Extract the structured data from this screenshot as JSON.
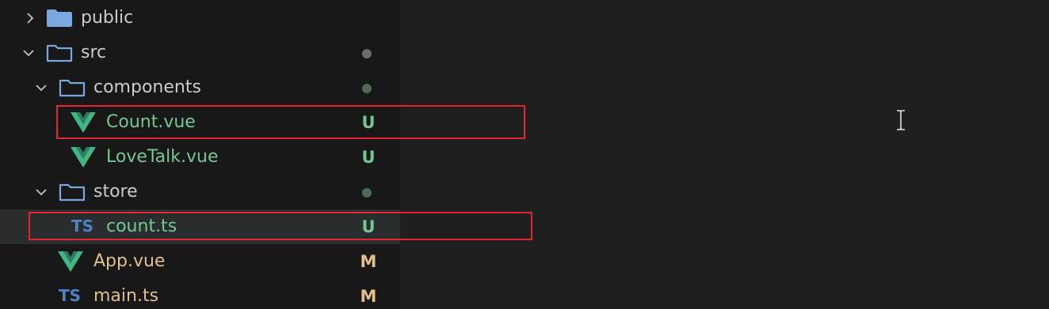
{
  "explorer": {
    "items": [
      {
        "label": "public",
        "chevron": "right",
        "icon": "folder-closed-filled"
      },
      {
        "label": "src",
        "chevron": "down",
        "icon": "folder-open-outline",
        "status_dot": true
      },
      {
        "label": "components",
        "chevron": "down",
        "icon": "folder-open-outline",
        "status_dot": true
      },
      {
        "label": "Count.vue",
        "icon": "vue-icon",
        "status": "U"
      },
      {
        "label": "LoveTalk.vue",
        "icon": "vue-icon",
        "status": "U"
      },
      {
        "label": "store",
        "chevron": "down",
        "icon": "folder-open-outline",
        "status_dot": true
      },
      {
        "label": "count.ts",
        "icon": "typescript-icon",
        "icon_text": "TS",
        "status": "U",
        "selected": true
      },
      {
        "label": "App.vue",
        "icon": "vue-icon",
        "status": "M"
      },
      {
        "label": "main.ts",
        "icon": "typescript-icon",
        "icon_text": "TS",
        "status": "M"
      }
    ]
  },
  "colors": {
    "sidebar_bg": "#181818",
    "editor_bg": "#1f1f1f",
    "untracked": "#73c991",
    "modified": "#e2c08d",
    "folder": "#7aa7e0",
    "vue": "#41b883",
    "typescript": "#4e82c6",
    "highlight_box": "#e3262f",
    "status_dot": "#6c6c6c"
  }
}
